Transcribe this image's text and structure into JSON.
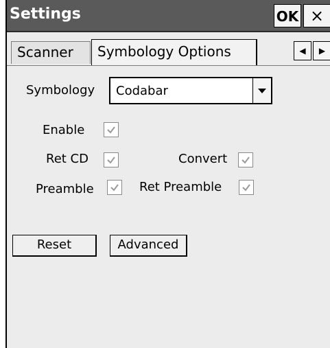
{
  "window": {
    "title": "Settings",
    "ok_label": "OK",
    "close_label": "×"
  },
  "tabs": [
    {
      "label": "Scanner",
      "active": false
    },
    {
      "label": "Symbology Options",
      "active": true
    }
  ],
  "tab_scroll": {
    "left_icon": "◀",
    "right_icon": "▶"
  },
  "symbology": {
    "label": "Symbology",
    "selected": "Codabar"
  },
  "options": {
    "enable": {
      "label": "Enable",
      "checked": true
    },
    "ret_cd": {
      "label": "Ret CD",
      "checked": true
    },
    "convert": {
      "label": "Convert",
      "checked": true
    },
    "preamble": {
      "label": "Preamble",
      "checked": true
    },
    "ret_preamble": {
      "label": "Ret Preamble",
      "checked": true
    }
  },
  "buttons": {
    "reset": "Reset",
    "advanced": "Advanced"
  }
}
